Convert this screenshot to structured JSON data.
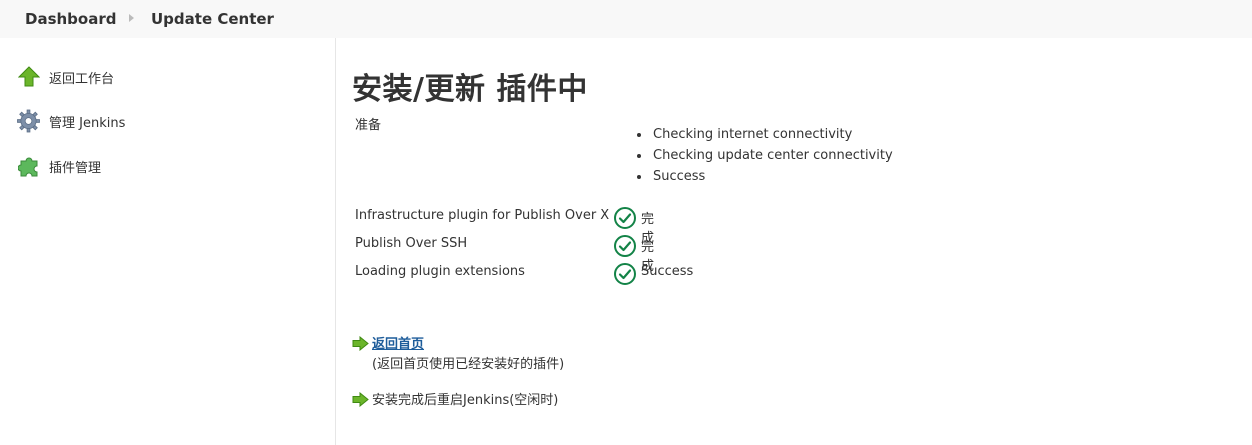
{
  "breadcrumb": {
    "items": [
      "Dashboard",
      "Update Center"
    ]
  },
  "sidebar": {
    "items": [
      {
        "label": "返回工作台",
        "icon": "up-arrow-icon"
      },
      {
        "label": "管理 Jenkins",
        "icon": "gear-icon"
      },
      {
        "label": "插件管理",
        "icon": "puzzle-icon"
      }
    ]
  },
  "main": {
    "title": "安装/更新 插件中",
    "preparation": {
      "label": "准备",
      "checks": [
        "Checking internet connectivity",
        "Checking update center connectivity",
        "Success"
      ]
    },
    "plugins": [
      {
        "name": "Infrastructure plugin for Publish Over X",
        "status": "完成"
      },
      {
        "name": "Publish Over SSH",
        "status": "完成"
      },
      {
        "name": "Loading plugin extensions",
        "status": "Success"
      }
    ],
    "actions": {
      "back_home_link": "返回首页",
      "back_home_desc": "(返回首页使用已经安装好的插件)",
      "restart_label": "安装完成后重启Jenkins(空闲时)"
    }
  },
  "colors": {
    "success_green": "#138347",
    "arrow_green": "#6bb52a",
    "link_blue": "#1d5c9a"
  }
}
